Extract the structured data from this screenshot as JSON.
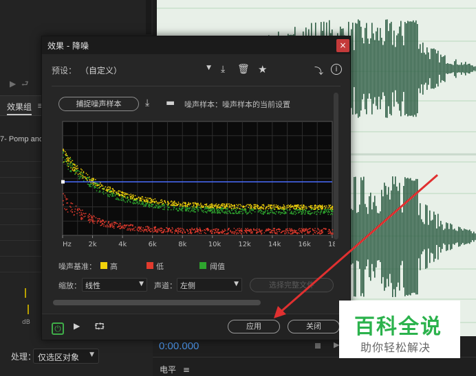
{
  "background": {
    "panel_tab": "效果组",
    "panel_tab_menu": "≡",
    "rack_item": "7- Pomp and",
    "db_label": "dB",
    "process_label": "处理：",
    "process_value": "仅选区对象",
    "time": "0:00.000",
    "level_label": "电平",
    "level_menu": "≡"
  },
  "dialog": {
    "title": "效果 - 降噪",
    "close": "×",
    "preset_label": "预设：",
    "preset_value": "（自定义）",
    "capture_button": "捕捉噪声样本",
    "noise_sample_text": "噪声样本：噪声样本的当前设置",
    "graph": {
      "x_ticks": [
        "Hz",
        "2k",
        "4k",
        "6k",
        "8k",
        "10k",
        "12k",
        "14k",
        "16k",
        "18"
      ]
    },
    "legend": {
      "label": "噪声基准：",
      "items": [
        {
          "name": "高",
          "color": "#f2d20a"
        },
        {
          "name": "低",
          "color": "#e23b2e"
        },
        {
          "name": "阈值",
          "color": "#2ea52e"
        }
      ]
    },
    "scale_label": "缩放：",
    "scale_value": "线性",
    "channel_label": "声道：",
    "channel_value": "左侧",
    "select_full_file": "选择完整文件",
    "apply_button": "应用",
    "close_button": "关闭"
  },
  "watermark": {
    "title": "百科全说",
    "subtitle": "助你轻松解决"
  },
  "colors": {
    "accent_blue": "#4a90e2",
    "close_red": "#c43a3a",
    "power_green": "#3fae49",
    "arrow_red": "#e03030",
    "watermark_green": "#2bb24c"
  }
}
